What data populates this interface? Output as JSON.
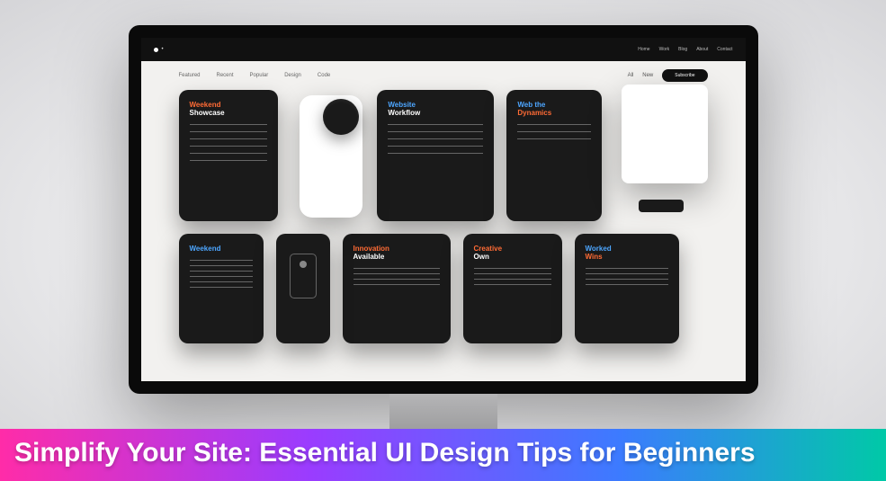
{
  "caption": "Simplify Your Site: Essential UI Design Tips for Beginners",
  "header": {
    "brand": "•",
    "nav": [
      "Home",
      "Work",
      "Blog",
      "About",
      "Contact"
    ]
  },
  "filters": {
    "left": [
      "Featured",
      "Recent",
      "Popular",
      "Design",
      "Code"
    ],
    "right_labels": [
      "All",
      "New"
    ],
    "pill": "Subscribe"
  },
  "cards_row1": [
    {
      "title_a": "Weekend",
      "title_b": "Showcase"
    },
    {
      "device": true
    },
    {
      "title_a": "Website",
      "title_b": "Workflow"
    },
    {
      "title_a": "Web the",
      "title_b": "Dynamics"
    },
    {
      "blank_panel": true
    }
  ],
  "cards_row2": [
    {
      "title": "Weekend"
    },
    {
      "icon_card": true
    },
    {
      "title_a": "Innovation",
      "title_b": "Available"
    },
    {
      "title_a": "Creative",
      "title_b": "Own"
    },
    {
      "title_a": "Worked",
      "title_b": "Wins"
    }
  ]
}
